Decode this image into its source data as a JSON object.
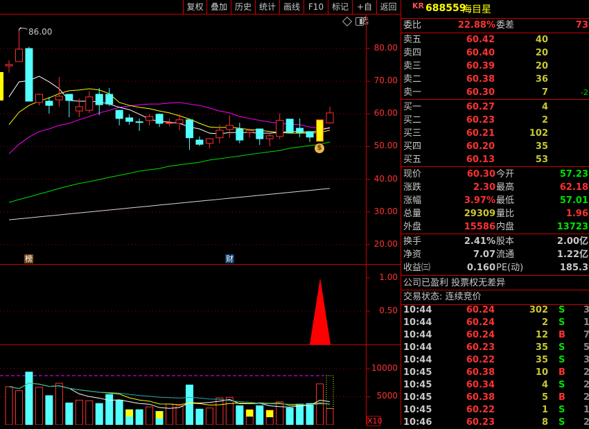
{
  "toolbar": {
    "buttons": [
      "复权",
      "叠加",
      "历史",
      "统计",
      "画线",
      "F10",
      "标记",
      "+自选",
      "返回"
    ]
  },
  "stock": {
    "market_tag": "KR",
    "code": "688559",
    "name": "海目星"
  },
  "commission": {
    "ratio_label": "委比",
    "ratio": "22.88%",
    "diff_label": "委差",
    "diff": "73"
  },
  "asks": [
    {
      "label": "卖五",
      "price": "60.42",
      "qty": "40",
      "chg": ""
    },
    {
      "label": "卖四",
      "price": "60.40",
      "qty": "20",
      "chg": ""
    },
    {
      "label": "卖三",
      "price": "60.39",
      "qty": "20",
      "chg": ""
    },
    {
      "label": "卖二",
      "price": "60.38",
      "qty": "36",
      "chg": ""
    },
    {
      "label": "卖一",
      "price": "60.30",
      "qty": "7",
      "chg": "-2"
    }
  ],
  "bids": [
    {
      "label": "买一",
      "price": "60.27",
      "qty": "4"
    },
    {
      "label": "买二",
      "price": "60.23",
      "qty": "2"
    },
    {
      "label": "买三",
      "price": "60.21",
      "qty": "102"
    },
    {
      "label": "买四",
      "price": "60.20",
      "qty": "35"
    },
    {
      "label": "买五",
      "price": "60.13",
      "qty": "53"
    }
  ],
  "quote": [
    {
      "l1": "现价",
      "v1": "60.30",
      "c1": "red",
      "l2": "今开",
      "v2": "57.23",
      "c2": "green"
    },
    {
      "l1": "涨跌",
      "v1": "2.30",
      "c1": "red",
      "l2": "最高",
      "v2": "62.18",
      "c2": "red"
    },
    {
      "l1": "涨幅",
      "v1": "3.97%",
      "c1": "red",
      "l2": "最低",
      "v2": "57.01",
      "c2": "green"
    },
    {
      "l1": "总量",
      "v1": "29309",
      "c1": "yellow",
      "l2": "量比",
      "v2": "1.96",
      "c2": "red"
    },
    {
      "l1": "外盘",
      "v1": "15586",
      "c1": "red",
      "l2": "内盘",
      "v2": "13723",
      "c2": "green"
    }
  ],
  "fundamentals": [
    {
      "l1": "换手",
      "v1": "2.41%",
      "l2": "股本",
      "v2": "2.00亿"
    },
    {
      "l1": "净资",
      "v1": "7.07",
      "l2": "流通",
      "v2": "1.22亿"
    },
    {
      "l1": "收益㈢",
      "v1": "0.160",
      "l2": "PE(动)",
      "v2": "185.3"
    }
  ],
  "notes": {
    "profit": "公司已盈利 投票权无差异",
    "trade_status": "交易状态: 连续竞价"
  },
  "ticks": [
    {
      "time": "10:44",
      "price": "60.24",
      "vol": "302",
      "bs": "S",
      "n": "3"
    },
    {
      "time": "10:44",
      "price": "60.24",
      "vol": "2",
      "bs": "S",
      "n": "1"
    },
    {
      "time": "10:44",
      "price": "60.24",
      "vol": "12",
      "bs": "B",
      "n": "7"
    },
    {
      "time": "10:44",
      "price": "60.23",
      "vol": "35",
      "bs": "S",
      "n": "5"
    },
    {
      "time": "10:44",
      "price": "60.22",
      "vol": "35",
      "bs": "S",
      "n": "3"
    },
    {
      "time": "10:45",
      "price": "60.38",
      "vol": "10",
      "bs": "B",
      "n": "2"
    },
    {
      "time": "10:45",
      "price": "60.34",
      "vol": "4",
      "bs": "S",
      "n": "2"
    },
    {
      "time": "10:45",
      "price": "60.38",
      "vol": "5",
      "bs": "B",
      "n": "2"
    },
    {
      "time": "10:45",
      "price": "60.22",
      "vol": "1",
      "bs": "S",
      "n": "1"
    },
    {
      "time": "10:46",
      "price": "60.23",
      "vol": "8",
      "bs": "S",
      "n": "2"
    }
  ],
  "chart_markers": {
    "high_label": "86.00",
    "tag_rank": "榜",
    "tag_finance": "财",
    "volume_scale": "X10"
  },
  "colors": {
    "up": "#ff3232",
    "down": "#54ffff",
    "grid": "#a00000",
    "ma5": "#ffffff",
    "ma10": "#ffff00",
    "ma20": "#ff00ff",
    "ma60": "#00e000",
    "ma120": "#d8d8d8"
  },
  "chart_data": [
    {
      "type": "candlestick",
      "price_axis": {
        "ticks": [
          "80.00",
          "70.00",
          "60.00",
          "50.00",
          "40.00",
          "30.00",
          "20.00"
        ],
        "range": [
          20,
          80
        ]
      },
      "ohlc": [
        [
          74.7,
          76.4,
          72.6,
          75.1
        ],
        [
          76.0,
          85.9,
          76.0,
          79.8
        ],
        [
          80.0,
          80.5,
          63.9,
          63.9
        ],
        [
          63.5,
          66.2,
          62.6,
          66.0
        ],
        [
          63.9,
          65.2,
          60.1,
          62.6
        ],
        [
          64.3,
          71.3,
          62.2,
          65.4
        ],
        [
          66.0,
          66.0,
          59.0,
          64.1
        ],
        [
          60.9,
          64.7,
          59.0,
          62.2
        ],
        [
          61.1,
          66.9,
          60.3,
          65.2
        ],
        [
          66.0,
          67.9,
          59.6,
          62.8
        ],
        [
          66.0,
          67.9,
          62.4,
          63.0
        ],
        [
          61.1,
          61.1,
          56.5,
          58.6
        ],
        [
          58.8,
          59.9,
          56.7,
          57.7
        ],
        [
          57.6,
          58.6,
          54.8,
          57.5
        ],
        [
          58.0,
          59.9,
          56.5,
          59.2
        ],
        [
          59.9,
          60.1,
          56.0,
          57.1
        ],
        [
          57.1,
          58.6,
          56.3,
          57.3
        ],
        [
          57.1,
          59.9,
          55.0,
          58.2
        ],
        [
          58.2,
          58.2,
          49.0,
          52.7
        ],
        [
          52.0,
          53.1,
          50.2,
          50.7
        ],
        [
          51.0,
          52.6,
          49.5,
          52.4
        ],
        [
          52.7,
          56.7,
          51.0,
          55.0
        ],
        [
          55.2,
          59.6,
          52.7,
          56.5
        ],
        [
          55.4,
          57.3,
          51.0,
          52.0
        ],
        [
          54.3,
          55.4,
          52.7,
          54.9
        ],
        [
          55.4,
          55.4,
          50.5,
          52.4
        ],
        [
          52.4,
          54.1,
          50.1,
          53.3
        ],
        [
          53.1,
          60.1,
          52.2,
          58.0
        ],
        [
          58.4,
          58.4,
          54.3,
          54.3
        ],
        [
          55.6,
          58.6,
          52.9,
          54.3
        ],
        [
          54.6,
          54.6,
          51.4,
          52.9
        ],
        [
          51.6,
          58.2,
          51.6,
          58.2
        ],
        [
          57.23,
          62.18,
          57.01,
          60.3
        ]
      ],
      "highlight_candle": 31,
      "ma": {
        "ma5": [
          65.2,
          69.8,
          70.2,
          71.5,
          69.8,
          67.7,
          64.1,
          63.9,
          63.9,
          63.7,
          63.0,
          62.0,
          61.3,
          59.9,
          58.4,
          57.7,
          57.5,
          57.1,
          56.0,
          55.4,
          54.1,
          53.9,
          54.3,
          54.3,
          54.3,
          54.1,
          54.1,
          54.3,
          54.6,
          54.6,
          54.3,
          55.0,
          55.8
        ],
        "ma10": [
          56.7,
          60.5,
          62.6,
          63.9,
          64.9,
          66.2,
          67.1,
          67.3,
          67.7,
          67.3,
          66.2,
          63.5,
          62.6,
          62.0,
          61.6,
          60.9,
          60.3,
          59.4,
          58.4,
          57.1,
          56.0,
          55.8,
          56.0,
          55.6,
          55.2,
          55.0,
          54.6,
          54.3,
          54.1,
          54.1,
          54.1,
          54.3,
          55.0
        ],
        "ma20": [
          47.8,
          50.7,
          52.9,
          54.6,
          55.4,
          56.5,
          57.1,
          58.2,
          59.2,
          60.3,
          61.1,
          62.0,
          62.4,
          62.8,
          63.0,
          63.0,
          63.3,
          63.5,
          63.0,
          62.6,
          61.8,
          60.9,
          60.3,
          59.2,
          58.6,
          58.0,
          57.5,
          57.1,
          56.9,
          56.7,
          56.0,
          55.6,
          55.6
        ],
        "ma60": [
          32.9,
          33.8,
          34.6,
          35.5,
          36.3,
          37.2,
          38.0,
          38.7,
          39.3,
          39.9,
          40.6,
          41.2,
          41.8,
          42.5,
          42.9,
          43.3,
          44.0,
          44.4,
          44.8,
          45.2,
          45.9,
          46.3,
          46.7,
          47.1,
          47.6,
          48.0,
          48.4,
          48.8,
          49.5,
          49.9,
          50.3,
          50.7,
          51.4
        ],
        "ma120": [
          27.6,
          27.9,
          28.2,
          28.5,
          28.8,
          29.1,
          29.4,
          29.7,
          30.0,
          30.3,
          30.6,
          30.9,
          31.2,
          31.5,
          31.8,
          32.1,
          32.4,
          32.7,
          33.0,
          33.3,
          33.6,
          33.9,
          34.2,
          34.5,
          34.8,
          35.1,
          35.4,
          35.7,
          36.0,
          36.3,
          36.6,
          36.9,
          37.2
        ]
      }
    },
    {
      "type": "area",
      "axis": {
        "ticks": [
          "1.00",
          "0.50"
        ],
        "range": [
          0,
          1
        ]
      },
      "values_last": [
        0,
        1,
        0
      ]
    },
    {
      "type": "bar",
      "axis": {
        "ticks": [
          "10000",
          "5000"
        ],
        "range": [
          0,
          15000
        ]
      },
      "volume": [
        6800,
        6100,
        9400,
        6700,
        5200,
        7400,
        3900,
        4400,
        4300,
        3800,
        5400,
        4400,
        2700,
        2700,
        3200,
        2400,
        3700,
        3400,
        7100,
        2800,
        3000,
        4800,
        4900,
        3400,
        2700,
        3400,
        2600,
        4100,
        3000,
        3700,
        3800,
        7300,
        2900
      ],
      "yellow_marked": [
        12,
        15,
        24,
        26
      ],
      "reference_level": 8770
    }
  ]
}
